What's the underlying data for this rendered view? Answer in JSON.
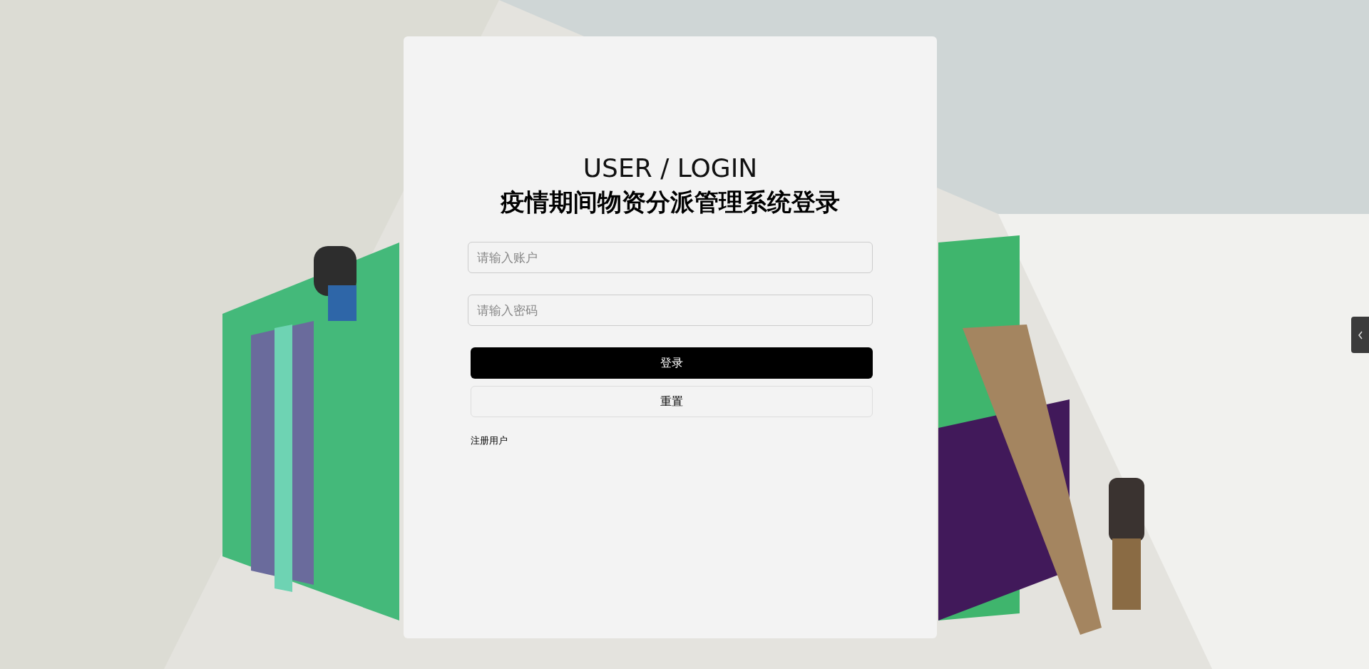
{
  "login": {
    "heading": "USER / LOGIN",
    "title": "疫情期间物资分派管理系统登录",
    "fields": [
      {
        "placeholder": "请输入账户"
      },
      {
        "placeholder": "请输入密码"
      }
    ],
    "buttons": [
      {
        "kind": "primary",
        "label": "登录"
      },
      {
        "kind": "outline",
        "label": "重置"
      }
    ],
    "register_link": "注册用户"
  }
}
